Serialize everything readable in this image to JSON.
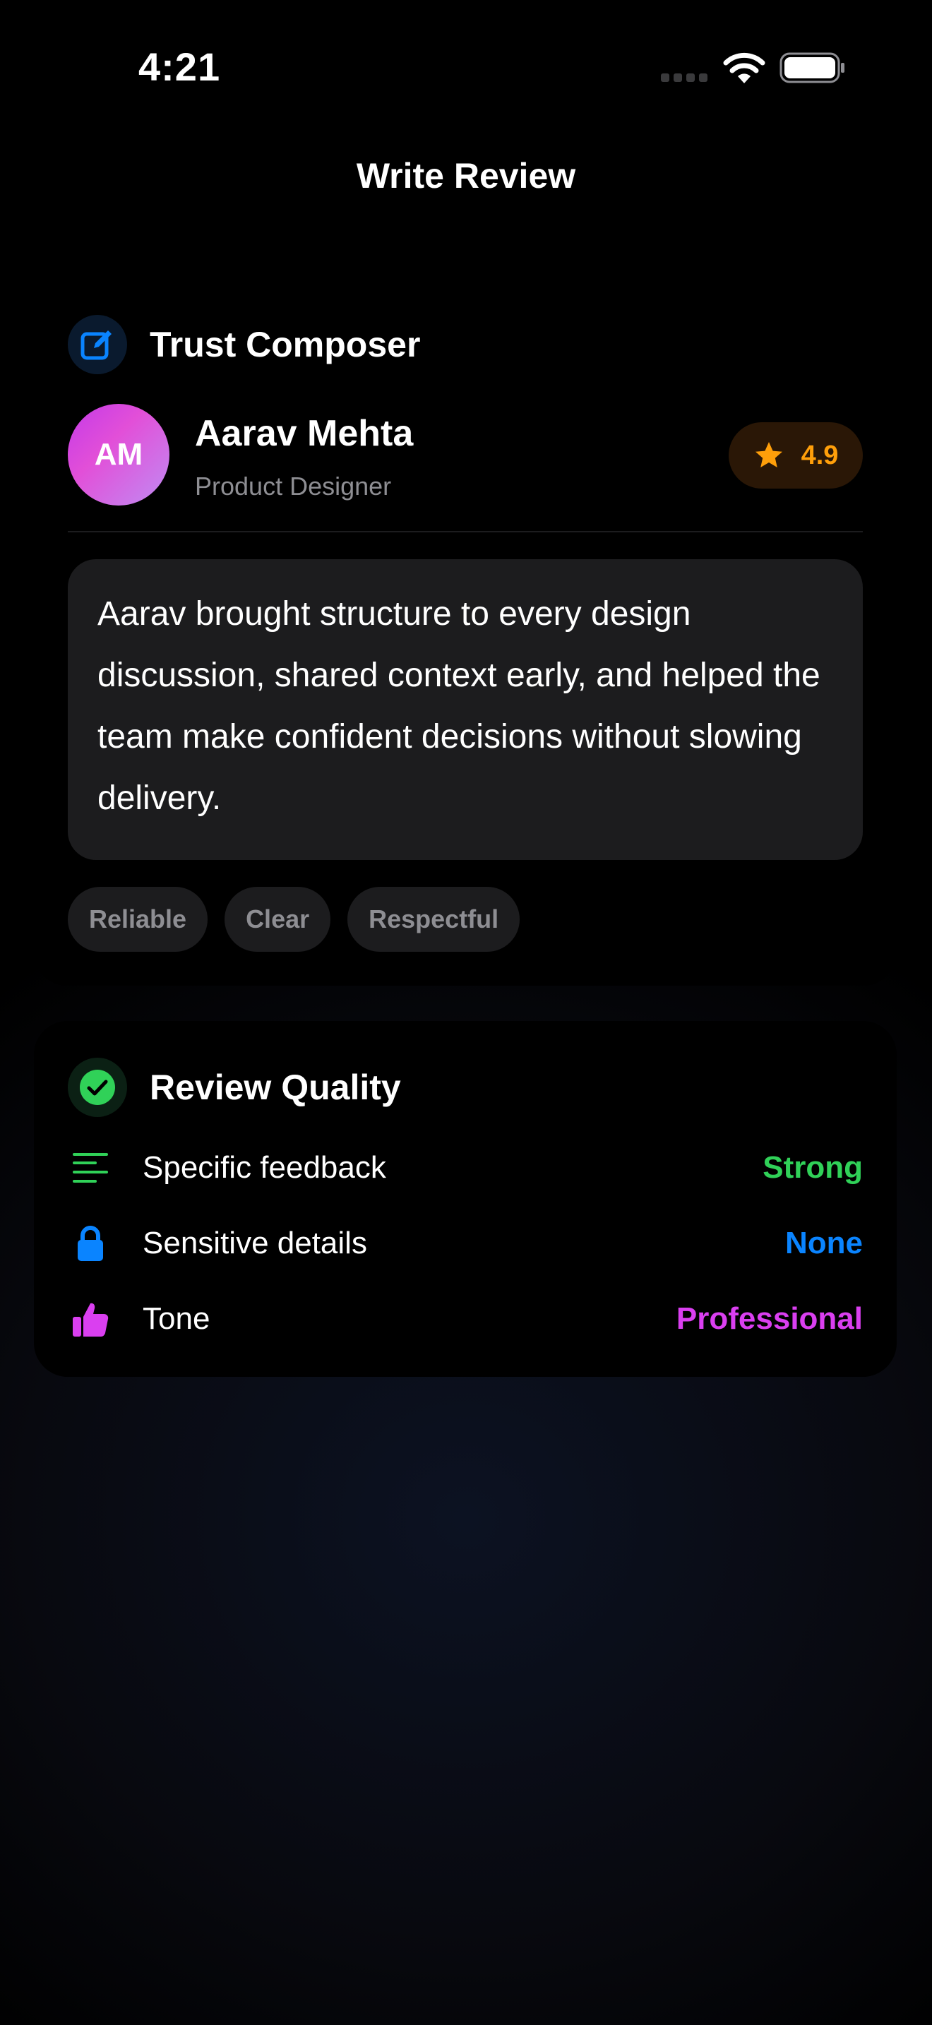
{
  "status_bar": {
    "time": "4:21"
  },
  "nav": {
    "title": "Write Review"
  },
  "composer": {
    "title": "Trust Composer",
    "icon": "compose-icon",
    "person": {
      "initials": "AM",
      "name": "Aarav Mehta",
      "role": "Product Designer",
      "rating": "4.9",
      "rating_icon": "star-icon"
    },
    "review_text": "Aarav brought structure to every design discussion, shared context early, and helped the team make confident decisions without slowing delivery.",
    "tags": [
      "Reliable",
      "Clear",
      "Respectful"
    ]
  },
  "quality": {
    "title": "Review Quality",
    "icon": "checkmark-circle-icon",
    "rows": [
      {
        "label": "Specific feedback",
        "value": "Strong",
        "icon": "text-lines-icon",
        "color": "#30d158"
      },
      {
        "label": "Sensitive details",
        "value": "None",
        "icon": "lock-icon",
        "color": "#0a84ff"
      },
      {
        "label": "Tone",
        "value": "Professional",
        "icon": "thumbs-up-icon",
        "color": "#da3ff0"
      }
    ]
  },
  "colors": {
    "accent_blue": "#0a84ff",
    "accent_green": "#30d158",
    "accent_orange": "#ff9f0a",
    "accent_magenta": "#da3ff0",
    "card_background": "#000000",
    "surface": "#1c1c1e",
    "secondary_text": "#8e8e93"
  }
}
